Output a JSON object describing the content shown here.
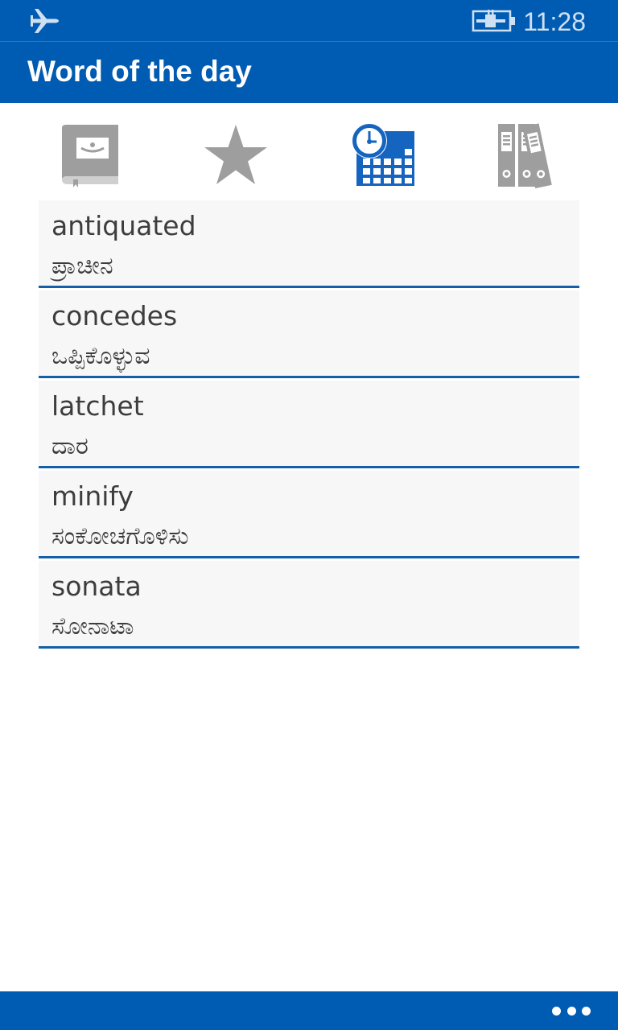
{
  "status_bar": {
    "time": "11:28",
    "airplane_icon": "airplane-icon",
    "battery_icon": "battery-charging-icon",
    "text_color": "#cfe0f3"
  },
  "header": {
    "title": "Word of the day",
    "background": "#005cb2"
  },
  "tabs": [
    {
      "icon": "dictionary-book-icon",
      "selected": false
    },
    {
      "icon": "star-icon",
      "selected": false
    },
    {
      "icon": "calendar-clock-icon",
      "selected": true
    },
    {
      "icon": "binders-icon",
      "selected": false
    }
  ],
  "words": [
    {
      "english": "antiquated",
      "kannada": "ಪ್ರಾಚೀನ"
    },
    {
      "english": "concedes",
      "kannada": "ಒಪ್ಪಿಕೊಳ್ಳುವ"
    },
    {
      "english": "latchet",
      "kannada": "ದಾರ"
    },
    {
      "english": "minify",
      "kannada": "ಸಂಕೋಚಗೊಳಿಸು"
    },
    {
      "english": "sonata",
      "kannada": "ಸೋನಾಟಾ"
    }
  ],
  "app_bar": {
    "more_icon": "ellipsis-icon"
  },
  "colors": {
    "accent": "#005cb2",
    "selected_icon": "#1565c0",
    "inactive_icon": "#9e9e9e",
    "divider": "#155ea8",
    "row_background": "#f7f7f7"
  }
}
